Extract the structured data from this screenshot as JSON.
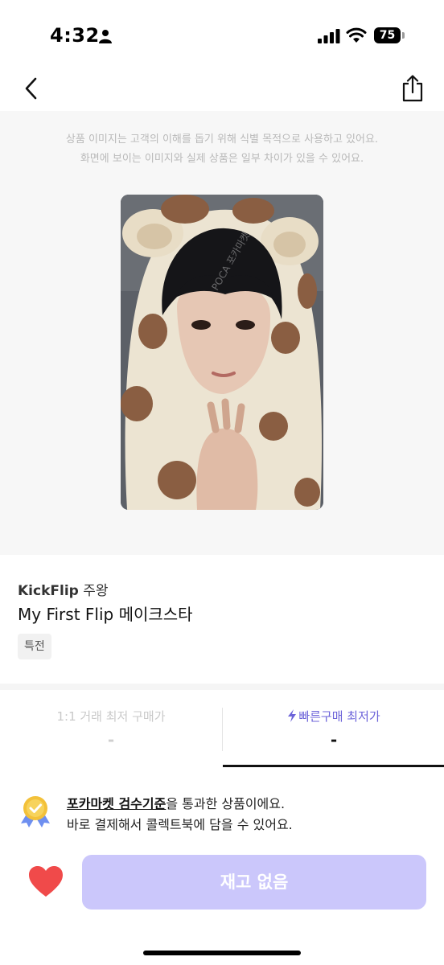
{
  "status_bar": {
    "time": "4:32",
    "battery": "75",
    "icons": [
      "person-icon",
      "signal-icon",
      "wifi-icon",
      "battery-icon"
    ]
  },
  "nav": {
    "back_icon": "chevron-left-icon",
    "share_icon": "share-icon"
  },
  "image_section": {
    "notice_line1": "상품 이미지는 고객의 이해를 돕기 위해 식별 목적으로 사용하고 있어요.",
    "notice_line2": "화면에 보이는 이미지와 실제 상품은 일부 차이가 있을 수 있어요.",
    "watermark": "POCA 포카마켓"
  },
  "product": {
    "artist": "KickFlip",
    "member": "주왕",
    "album": "My First Flip 메이크스타",
    "tag": "특전"
  },
  "price_tabs": [
    {
      "label": "1:1 거래 최저 구매가",
      "value": "-",
      "active": false
    },
    {
      "label": "빠른구매 최저가",
      "value": "-",
      "active": true,
      "icon": "bolt-icon"
    }
  ],
  "inspection": {
    "link_text": "포카마켓 검수기준",
    "line1_rest": "을 통과한 상품이에요.",
    "line2": "바로 결제해서 콜렉트북에 담을 수 있어요.",
    "icon": "medal-icon"
  },
  "bottom": {
    "wishlist_icon": "heart-icon",
    "buy_button": "재고 없음"
  },
  "colors": {
    "accent": "#6c63d9",
    "button_disabled": "#cbc7fb",
    "heart": "#f04a4a",
    "image_bg": "#f7f7f7"
  }
}
